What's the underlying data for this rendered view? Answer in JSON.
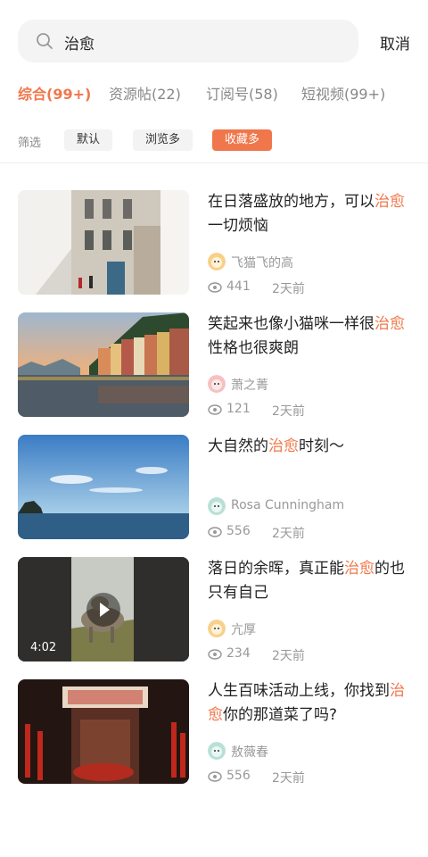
{
  "search": {
    "query": "治愈",
    "cancel_label": "取消"
  },
  "tabs": [
    {
      "label": "综合(99+)",
      "active": true
    },
    {
      "label": "资源帖(22)",
      "active": false
    },
    {
      "label": "订阅号(58)",
      "active": false
    },
    {
      "label": "短视频(99+)",
      "active": false
    }
  ],
  "filter": {
    "label": "筛选",
    "options": [
      {
        "label": "默认",
        "active": false
      },
      {
        "label": "浏览多",
        "active": false
      },
      {
        "label": "收藏多",
        "active": true
      }
    ]
  },
  "highlight_color": "#f0774b",
  "results": [
    {
      "title_pre": "在日落盛放的地方，可以",
      "title_hl": "治愈",
      "title_post": "一切烦恼",
      "author": "飞猫飞的高",
      "views": "441",
      "time": "2天前",
      "duration": ""
    },
    {
      "title_pre": "笑起来也像小猫咪一样很",
      "title_hl": "治愈",
      "title_post": "性格也很爽朗",
      "author": "萧之菁",
      "views": "121",
      "time": "2天前",
      "duration": ""
    },
    {
      "title_pre": "大自然的",
      "title_hl": "治愈",
      "title_post": "时刻～",
      "author": "Rosa Cunningham",
      "views": "556",
      "time": "2天前",
      "duration": ""
    },
    {
      "title_pre": "落日的余晖，真正能",
      "title_hl": "治愈",
      "title_post": "的也只有自己",
      "author": "亢厚",
      "views": "234",
      "time": "2天前",
      "duration": "4:02"
    },
    {
      "title_pre": "人生百味活动上线，你找到",
      "title_hl": "治愈",
      "title_post": "你的那道菜了吗?",
      "author": "敖薇春",
      "views": "556",
      "time": "2天前",
      "duration": ""
    }
  ]
}
